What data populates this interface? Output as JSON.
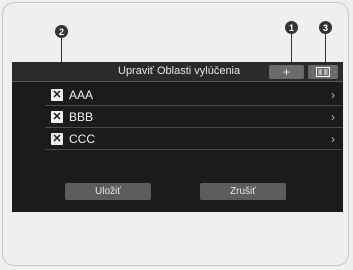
{
  "header": {
    "title": "Upraviť Oblasti vylúčenia"
  },
  "toolbar": {
    "add_glyph": "+",
    "add_icon": "plus-icon",
    "menu_icon": "list-menu-icon"
  },
  "callouts": {
    "one": "1",
    "two": "2",
    "three": "3"
  },
  "list": {
    "items": [
      {
        "label": "AAA",
        "checked": true
      },
      {
        "label": "BBB",
        "checked": true
      },
      {
        "label": "CCC",
        "checked": true
      }
    ],
    "check_glyph": "✕",
    "chevron_glyph": "›"
  },
  "footer": {
    "save_label": "Uložiť",
    "cancel_label": "Zrušiť"
  },
  "colors": {
    "screen_bg": "#1b1b1b",
    "button_bg": "#5c5c5c",
    "callout": "#333333"
  }
}
